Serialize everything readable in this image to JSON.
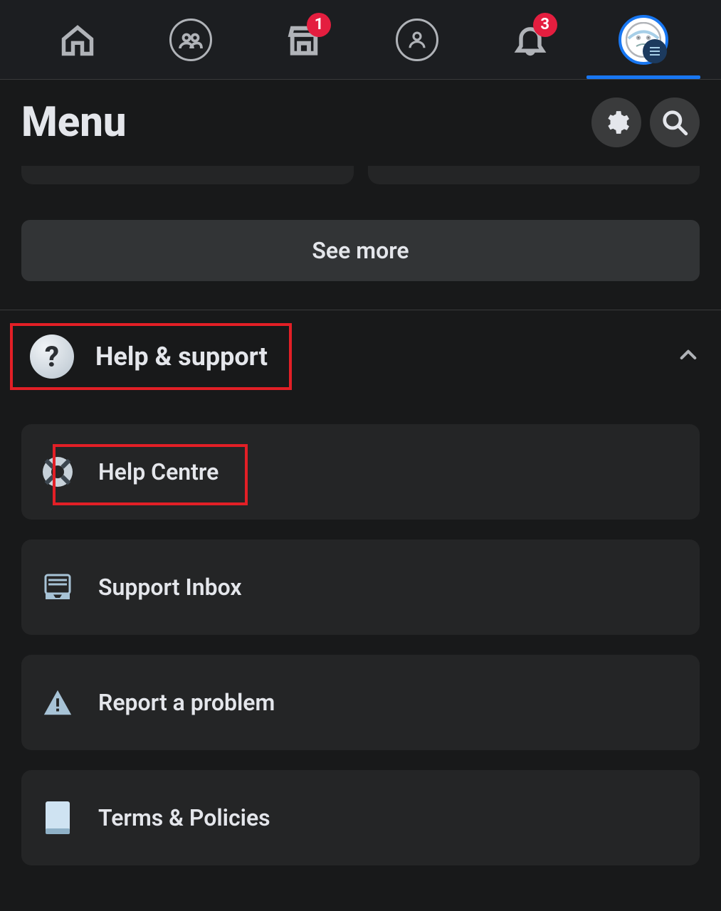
{
  "topnav": {
    "marketplace_badge": "1",
    "notifications_badge": "3"
  },
  "header": {
    "title": "Menu"
  },
  "see_more": {
    "label": "See more"
  },
  "help_support": {
    "title": "Help & support",
    "items": [
      {
        "label": "Help Centre"
      },
      {
        "label": "Support Inbox"
      },
      {
        "label": "Report a problem"
      },
      {
        "label": "Terms & Policies"
      }
    ]
  }
}
